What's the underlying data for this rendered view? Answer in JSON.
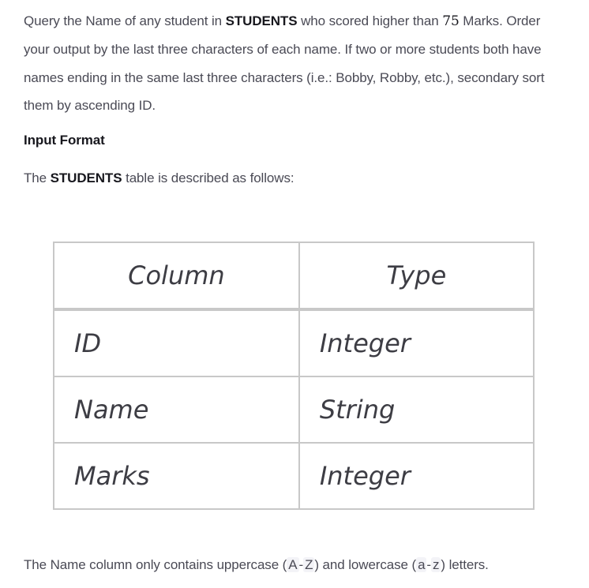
{
  "problem": {
    "p1_before_students": "Query the Name of any student in ",
    "p1_students": "STUDENTS",
    "p1_between": " who scored higher than ",
    "p1_number": "75",
    "p1_after": " Marks. Order your output by the last three characters of each name. If two or more students both have names ending in the same last three characters (i.e.: Bobby, Robby, etc.), secondary sort them by ascending ID."
  },
  "input_format": {
    "heading": "Input Format",
    "desc_before": "The ",
    "desc_table": "STUDENTS",
    "desc_after": " table is described as follows:"
  },
  "table": {
    "headers": [
      "Column",
      "Type"
    ],
    "rows": [
      [
        "ID",
        "Integer"
      ],
      [
        "Name",
        "String"
      ],
      [
        "Marks",
        "Integer"
      ]
    ]
  },
  "footer": {
    "before": "The Name column only contains uppercase (",
    "upper": "A",
    "dash1": "-",
    "upper_end": "Z",
    "middle": ") and lowercase (",
    "lower": "a",
    "dash2": "-",
    "lower_end": "z",
    "after": ") letters."
  }
}
